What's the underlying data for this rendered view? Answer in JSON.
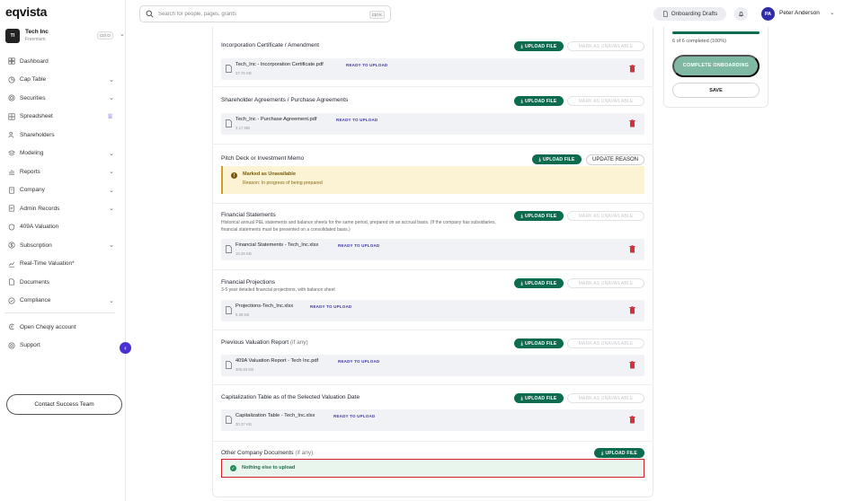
{
  "app": {
    "logo": "eqvista"
  },
  "company": {
    "initials": "TI",
    "name": "Tech Inc",
    "plan": "Freemium",
    "shortcut": "Ctrl O"
  },
  "sidebar": {
    "items": [
      {
        "label": "Dashboard",
        "icon": "dashboard-icon",
        "caret": false
      },
      {
        "label": "Cap Table",
        "icon": "pie-icon",
        "caret": true
      },
      {
        "label": "Securities",
        "icon": "coin-icon",
        "caret": true
      },
      {
        "label": "Spreadsheet",
        "icon": "grid-icon",
        "caret": false,
        "crown": true
      },
      {
        "label": "Shareholders",
        "icon": "users-icon",
        "caret": false
      },
      {
        "label": "Modeling",
        "icon": "layers-icon",
        "caret": true
      },
      {
        "label": "Reports",
        "icon": "chart-icon",
        "caret": true
      },
      {
        "label": "Company",
        "icon": "building-icon",
        "caret": true
      },
      {
        "label": "Admin Records",
        "icon": "records-icon",
        "caret": true
      },
      {
        "label": "409A Valuation",
        "icon": "shield-icon",
        "caret": false
      },
      {
        "label": "Subscription",
        "icon": "dollar-icon",
        "caret": true
      },
      {
        "label": "Real-Time Valuation*",
        "icon": "trend-icon",
        "caret": false
      },
      {
        "label": "Documents",
        "icon": "document-icon",
        "caret": false
      },
      {
        "label": "Compliance",
        "icon": "check-shield-icon",
        "caret": true
      }
    ],
    "secondary": [
      {
        "label": "Open Cheqly account",
        "icon": "cheqly-icon"
      },
      {
        "label": "Support",
        "icon": "help-icon"
      }
    ],
    "contact_label": "Contact Success Team"
  },
  "header": {
    "search_placeholder": "Search for people, pages, grants",
    "search_shortcut": "Ctrl K",
    "onboarding_label": "Onboarding Drafts",
    "user_initials": "PA",
    "user_name": "Peter Anderson"
  },
  "labels": {
    "upload": "UPLOAD FILE",
    "mark_unavailable": "MARK AS UNAVAILABLE",
    "update_reason": "UPDATE REASON",
    "ready": "READY TO UPLOAD"
  },
  "documents": [
    {
      "title": "Incorporation Certificate / Amendment",
      "file": "Tech_Inc - Incorporation Certificate.pdf",
      "size": "37.76 KB"
    },
    {
      "title": "Shareholder Agreements / Purchase Agreements",
      "file": "Tech_Inc - Purchase Agreement.pdf",
      "size": "2.17 MB"
    },
    {
      "title": "Pitch Deck or Investment Memo",
      "unavailable_title": "Marked as Unavailable",
      "unavailable_reason": "Reason: In progress of being prepared"
    },
    {
      "title": "Financial Statements",
      "desc": "Historical annual P&L statements and balance sheets for the same period, prepared on an accrual basis. (If the company has subsidiaries, financial statements must be presented on a consolidated basis.)",
      "file": "Financial Statements - Tech_Inc.xlsx",
      "size": "10.25 KB"
    },
    {
      "title": "Financial Projections",
      "desc": "3-5 year detailed financial projections, with balance sheet",
      "file": "Projections-Tech_Inc.xlsx",
      "size": "9.39 KB"
    },
    {
      "title": "Previous Valuation Report",
      "optional": "(if any)",
      "file": "409A Valuation Report - Tech Inc.pdf",
      "size": "306.83 KB"
    },
    {
      "title": "Capitalization Table as of the Selected Valuation Date",
      "file": "Capitalization Table - Tech_Inc.xlsx",
      "size": "30.37 KB"
    },
    {
      "title": "Other Company Documents",
      "optional": "(if any)",
      "nothing": "Nothing else to upload"
    }
  ],
  "progress": {
    "completed": 6,
    "total": 6,
    "fraction": 1.0,
    "text": "6 of 6 completed (100%)"
  },
  "actions": {
    "complete": "COMPLETE ONBOARDING",
    "save": "SAVE"
  }
}
